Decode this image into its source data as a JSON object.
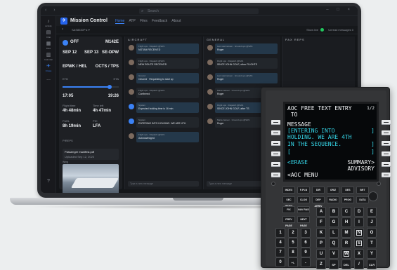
{
  "os": {
    "search_placeholder": "Search",
    "nav_arrows": "‹ ›",
    "window_controls": "– □ ×"
  },
  "rail": [
    "Activity",
    "Chat",
    "Files",
    "Calendar",
    "Calls",
    "Crews",
    "..."
  ],
  "app": {
    "logo": "✈",
    "title": "Mission Control",
    "tabs": [
      "Home",
      "ATP",
      "Files",
      "Feedback",
      "About"
    ],
    "breadcrumb": "SAS8530P ▸ ▾",
    "status_label": "Show live",
    "message_count": "Unread messages  0"
  },
  "flight": {
    "status": "OFF",
    "flight_no": "M142E",
    "date_dep": "SEP 12",
    "date_arr": "SEP 13",
    "reg": "SE-DPW",
    "route_from": "EPWK / HEL",
    "route_to": "OCTS / TPS",
    "time_label_left": "ETD",
    "time_label_right": "ETA",
    "time_left": "17:05",
    "time_right": "19:26",
    "dur1_label": "Flight time",
    "dur1": "4h 48min",
    "dur2_label": "Time left",
    "dur2": "4h 47min",
    "fuel_label": "FUEL",
    "fuel": "8h 19min",
    "crew_label": "PIC",
    "crew_value": "LFA",
    "status_line": "PIREPS",
    "attach_title": "Passenger manifest.pdf",
    "attach_sub": "Uploaded Sep 12, 2023",
    "media_label": "Wing"
  },
  "columns": [
    {
      "head": "AIRCRAFT"
    },
    {
      "head": "GENERAL"
    },
    {
      "head": "PAX REPS"
    }
  ],
  "aircraft_msgs": [
    {
      "from": "Flight ops · Dispatch @SAS",
      "text": "NOTAM RECEIVED"
    },
    {
      "from": "Flight ops · Dispatch @SAS",
      "text": "NEW ROUTE RECEIVED"
    },
    {
      "from": "Ground",
      "text": "Cleared · Requesting to start up"
    },
    {
      "from": "Flight ops · Dispatch @SAS",
      "text": "Confirmed"
    },
    {
      "from": "System",
      "text": "Expected holding time is 16 min"
    },
    {
      "from": "System",
      "text": "ENTERING INTO HOLDING. WE ARE 4TH"
    },
    {
      "from": "Flight ops · Dispatch @SAS",
      "text": "Acknowledged"
    }
  ],
  "general_msgs": [
    {
      "from": "Lars Hermansen · Ground ops @SAS",
      "text": "Roger"
    },
    {
      "from": "Flight ops · Dispatch @SAS",
      "text": "SINCE JOHN GOLF, other FLIGHTS"
    },
    {
      "from": "Lars Hermansen · Ground ops @SAS",
      "text": "Roger"
    },
    {
      "from": "Maria Jansen · Ground ops @SAS",
      "text": "Roger"
    },
    {
      "from": "Flight ops · Dispatch @SAS",
      "text": "SINCE JOHN GOLF, after TS"
    },
    {
      "from": "Maria Jansen · Ground ops @SAS",
      "text": "Roger"
    }
  ],
  "compose_placeholder": "Type a new message",
  "mcdu": {
    "title": "AOC FREE TEXT ENTRY",
    "page": "1/2",
    "line_to": " TO",
    "line_msg_label": "MESSAGE",
    "msg_lines": [
      "[ENTERING INTO",
      "HOLDING. WE ARE 4TH",
      "IN THE SEQUENCE."
    ],
    "empty_bracket": "[",
    "erase": "<ERASE",
    "summary": "SUMMARY>",
    "advisory": "ADVISORY",
    "menu": "<AOC MENU",
    "function_keys_row1": [
      "INDEX",
      "F-PLN",
      "DIR",
      "ORIZ",
      "DES",
      "BRT"
    ],
    "function_keys_row2": [
      "SEC INDEX",
      "CLOG",
      "DEP ARRIV",
      "RADIO",
      "PROG",
      "DATA"
    ],
    "function_keys_row3": [
      "FIX",
      "NAV RAD"
    ],
    "function_keys_row4": [
      "PREV PAGE",
      "NEXT PAGE"
    ],
    "alpha_rows": [
      [
        "A",
        "B",
        "C",
        "D",
        "E"
      ],
      [
        "F",
        "G",
        "H",
        "I",
        "J"
      ],
      [
        "K",
        "L",
        "M",
        "N",
        "O"
      ],
      [
        "P",
        "Q",
        "R",
        "S",
        "T"
      ],
      [
        "U",
        "V",
        "W",
        "X",
        "Y"
      ],
      [
        "Z",
        "SP",
        "DEL",
        "/",
        "CLR"
      ]
    ],
    "num_rows": [
      [
        "1",
        "2",
        "3"
      ],
      [
        "4",
        "5",
        "6"
      ],
      [
        "7",
        "8",
        "9"
      ],
      [
        "0",
        "+/-",
        "."
      ]
    ]
  }
}
